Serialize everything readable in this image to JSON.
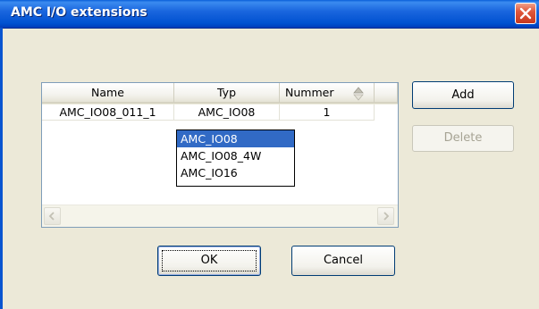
{
  "window": {
    "title": "AMC I/O extensions",
    "close_icon": "close-icon"
  },
  "listview": {
    "columns": [
      "Name",
      "Typ",
      "Nummer"
    ],
    "rows": [
      {
        "name": "AMC_IO08_011_1",
        "typ": "AMC_IO08",
        "nummer": "1"
      }
    ],
    "type_dropdown": {
      "options": [
        "AMC_IO08",
        "AMC_IO08_4W",
        "AMC_IO16"
      ],
      "selected_index": 0
    }
  },
  "buttons": {
    "add": "Add",
    "delete": "Delete",
    "ok": "OK",
    "cancel": "Cancel"
  },
  "colors": {
    "selection": "#316ac5",
    "titlebar": "#0051d0",
    "dialog_bg": "#ece9d8"
  }
}
